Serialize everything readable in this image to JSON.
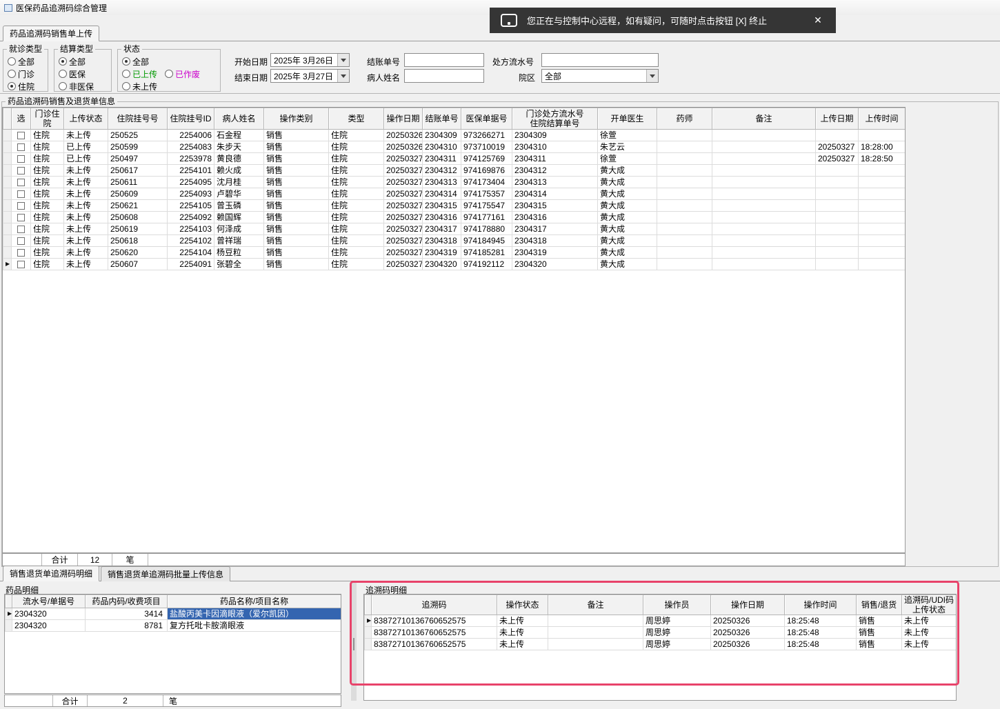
{
  "window": {
    "title": "医保药品追溯码综合管理"
  },
  "remote_banner": {
    "text": "您正在与控制中心远程，如有疑问，可随时点击按钮 [X] 终止",
    "close_label": "✕"
  },
  "main_tab": {
    "label": "药品追溯码销售单上传"
  },
  "filters": {
    "visit_type": {
      "label": "就诊类型",
      "options": [
        "全部",
        "门诊",
        "住院"
      ],
      "selected": "住院"
    },
    "settlement_type": {
      "label": "结算类型",
      "options": [
        "全部",
        "医保",
        "非医保"
      ],
      "selected": "全部"
    },
    "status": {
      "label": "状态",
      "options": [
        "全部",
        "已上传",
        "已作废",
        "未上传"
      ],
      "selected": "全部",
      "option_colors": {
        "已上传": "#009900",
        "已作废": "#cc00cc"
      }
    },
    "start_date": {
      "label": "开始日期",
      "value": "2025年 3月26日"
    },
    "end_date": {
      "label": "结束日期",
      "value": "2025年 3月27日"
    },
    "checkout_no": {
      "label": "结账单号",
      "value": ""
    },
    "patient_name": {
      "label": "病人姓名",
      "value": ""
    },
    "prescription_no": {
      "label": "处方流水号",
      "value": ""
    },
    "campus": {
      "label": "院区",
      "value": "全部"
    }
  },
  "sales": {
    "group_title": "药品追溯码销售及退货单信息",
    "columns": [
      "选",
      "门诊住院",
      "上传状态",
      "住院挂号号",
      "住院挂号ID",
      "病人姓名",
      "操作类别",
      "类型",
      "操作日期",
      "结账单号",
      "医保单据号",
      "门诊处方流水号\n住院结算单号",
      "开单医生",
      "药师",
      "备注",
      "上传日期",
      "上传时间"
    ],
    "current_row": 11,
    "rows": [
      [
        "住院",
        "未上传",
        "250525",
        "2254006",
        "石金程",
        "销售",
        "住院",
        "20250326",
        "2304309",
        "973266271",
        "2304309",
        "徐萱",
        "",
        "",
        "",
        ""
      ],
      [
        "住院",
        "已上传",
        "250599",
        "2254083",
        "朱步天",
        "销售",
        "住院",
        "20250326",
        "2304310",
        "973710019",
        "2304310",
        "朱艺云",
        "",
        "",
        "20250327",
        "18:28:00"
      ],
      [
        "住院",
        "已上传",
        "250497",
        "2253978",
        "黄良德",
        "销售",
        "住院",
        "20250327",
        "2304311",
        "974125769",
        "2304311",
        "徐萱",
        "",
        "",
        "20250327",
        "18:28:50"
      ],
      [
        "住院",
        "未上传",
        "250617",
        "2254101",
        "赖火成",
        "销售",
        "住院",
        "20250327",
        "2304312",
        "974169876",
        "2304312",
        "黄大成",
        "",
        "",
        "",
        ""
      ],
      [
        "住院",
        "未上传",
        "250611",
        "2254095",
        "沈月桂",
        "销售",
        "住院",
        "20250327",
        "2304313",
        "974173404",
        "2304313",
        "黄大成",
        "",
        "",
        "",
        ""
      ],
      [
        "住院",
        "未上传",
        "250609",
        "2254093",
        "卢碧华",
        "销售",
        "住院",
        "20250327",
        "2304314",
        "974175357",
        "2304314",
        "黄大成",
        "",
        "",
        "",
        ""
      ],
      [
        "住院",
        "未上传",
        "250621",
        "2254105",
        "曾玉磷",
        "销售",
        "住院",
        "20250327",
        "2304315",
        "974175547",
        "2304315",
        "黄大成",
        "",
        "",
        "",
        ""
      ],
      [
        "住院",
        "未上传",
        "250608",
        "2254092",
        "赖国辉",
        "销售",
        "住院",
        "20250327",
        "2304316",
        "974177161",
        "2304316",
        "黄大成",
        "",
        "",
        "",
        ""
      ],
      [
        "住院",
        "未上传",
        "250619",
        "2254103",
        "何泽成",
        "销售",
        "住院",
        "20250327",
        "2304317",
        "974178880",
        "2304317",
        "黄大成",
        "",
        "",
        "",
        ""
      ],
      [
        "住院",
        "未上传",
        "250618",
        "2254102",
        "曾祥瑞",
        "销售",
        "住院",
        "20250327",
        "2304318",
        "974184945",
        "2304318",
        "黄大成",
        "",
        "",
        "",
        ""
      ],
      [
        "住院",
        "未上传",
        "250620",
        "2254104",
        "杨豆粒",
        "销售",
        "住院",
        "20250327",
        "2304319",
        "974185281",
        "2304319",
        "黄大成",
        "",
        "",
        "",
        ""
      ],
      [
        "住院",
        "未上传",
        "250607",
        "2254091",
        "张碧全",
        "销售",
        "住院",
        "20250327",
        "2304320",
        "974192112",
        "2304320",
        "黄大成",
        "",
        "",
        "",
        ""
      ]
    ],
    "summary": {
      "label": "合计",
      "count": "12",
      "unit": "笔"
    }
  },
  "detail_tabs": [
    {
      "label": "销售退货单追溯码明细",
      "active": true
    },
    {
      "label": "销售退货单追溯码批量上传信息",
      "active": false
    }
  ],
  "drug_panel": {
    "title": "药品明细",
    "columns": [
      "流水号/单据号",
      "药品内码/收费项目",
      "药品名称/项目名称"
    ],
    "current_row": 0,
    "rows": [
      [
        "2304320",
        "3414",
        "盐酸丙美卡因滴眼液（爱尔凯因）"
      ],
      [
        "2304320",
        "8781",
        "复方托吡卡胺滴眼液"
      ]
    ],
    "summary": {
      "label": "合计",
      "count": "2",
      "unit": "笔"
    }
  },
  "trace_panel": {
    "title": "追溯码明细",
    "highlight_color": "#e8436a",
    "columns": [
      "追溯码",
      "操作状态",
      "备注",
      "操作员",
      "操作日期",
      "操作时间",
      "销售/退货",
      "追溯码/UDI码\n上传状态"
    ],
    "current_row": 0,
    "rows": [
      [
        "83872710136760652575",
        "未上传",
        "",
        "周思婷",
        "20250326",
        "18:25:48",
        "销售",
        "未上传"
      ],
      [
        "83872710136760652575",
        "未上传",
        "",
        "周思婷",
        "20250326",
        "18:25:48",
        "销售",
        "未上传"
      ],
      [
        "83872710136760652575",
        "未上传",
        "",
        "周思婷",
        "20250326",
        "18:25:48",
        "销售",
        "未上传"
      ]
    ]
  }
}
